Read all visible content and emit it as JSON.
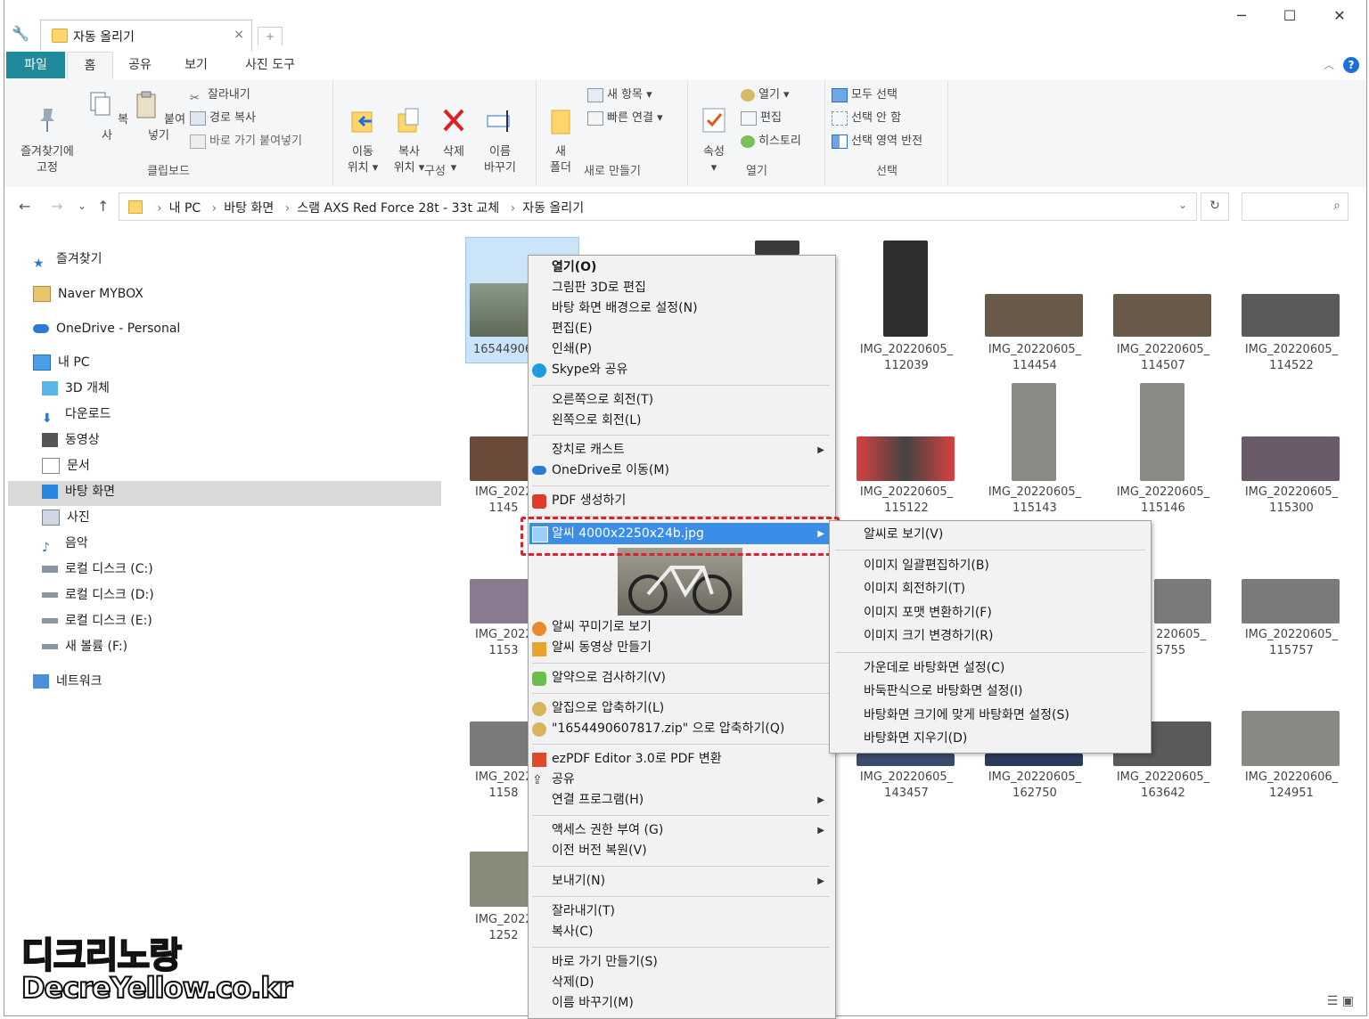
{
  "window": {
    "tab_title": "자동 올리기",
    "tab_close": "×",
    "new_tab": "+",
    "minimize": "─",
    "maximize": "☐",
    "close": "✕"
  },
  "ribbon_tabs": [
    "파일",
    "홈",
    "공유",
    "보기",
    "사진 도구"
  ],
  "ribbon": {
    "clipboard": {
      "pin_label": "즐겨찾기에\n고정",
      "copy_label": "복사",
      "paste_label": "붙여넣기",
      "cut": "잘라내기",
      "copy_path": "경로 복사",
      "paste_shortcut": "바로 가기 붙여넣기",
      "group": "클립보드"
    },
    "organize": {
      "move": "이동\n위치 ▾",
      "copy_to": "복사\n위치 ▾",
      "delete": "삭제\n▾",
      "rename": "이름\n바꾸기",
      "group": "구성"
    },
    "new": {
      "new_folder": "새\n폴더",
      "new_item": "새 항목 ▾",
      "easy_access": "빠른 연결 ▾",
      "group": "새로 만들기"
    },
    "open": {
      "properties": "속성\n▾",
      "open": "열기 ▾",
      "edit": "편집",
      "history": "히스토리",
      "group": "열기"
    },
    "select": {
      "select_all": "모두 선택",
      "select_none": "선택 안 함",
      "invert": "선택 영역 반전",
      "group": "선택"
    }
  },
  "nav_buttons": {
    "back": "←",
    "forward": "→",
    "recent": "⌄",
    "up": "↑"
  },
  "breadcrumb": [
    "내 PC",
    "바탕 화면",
    "스램 AXS Red Force 28t - 33t 교체",
    "자동 올리기"
  ],
  "breadcrumb_sep": "›",
  "address_dropdown": "⌄",
  "refresh": "↻",
  "search_icon": "⌕",
  "nav_pane": [
    {
      "label": "즐겨찾기",
      "icon": "star-icon"
    },
    {
      "label": "Naver MYBOX",
      "icon": "cloud-box-icon"
    },
    {
      "label": "OneDrive - Personal",
      "icon": "onedrive-icon"
    },
    {
      "label": "내 PC",
      "icon": "pc-icon"
    },
    {
      "label": "3D 개체",
      "icon": "cube-icon"
    },
    {
      "label": "다운로드",
      "icon": "download-icon"
    },
    {
      "label": "동영상",
      "icon": "video-icon"
    },
    {
      "label": "문서",
      "icon": "document-icon"
    },
    {
      "label": "바탕 화면",
      "icon": "desktop-icon"
    },
    {
      "label": "사진",
      "icon": "picture-icon"
    },
    {
      "label": "음악",
      "icon": "music-icon"
    },
    {
      "label": "로컬 디스크 (C:)",
      "icon": "drive-icon"
    },
    {
      "label": "로컬 디스크 (D:)",
      "icon": "drive-icon"
    },
    {
      "label": "로컬 디스크 (E:)",
      "icon": "drive-icon"
    },
    {
      "label": "새 볼륨 (F:)",
      "icon": "drive-icon"
    },
    {
      "label": "네트워크",
      "icon": "network-icon"
    }
  ],
  "files": {
    "selected": "16544906",
    "col1": [
      "IMG_2022\n1145",
      "IMG_2022\n1153",
      "IMG_2022\n1158",
      "IMG_2022\n1252"
    ],
    "grid": [
      [
        "IMG_20220605_\n112039",
        "IMG_20220605_\n114454",
        "IMG_20220605_\n114507",
        "IMG_20220605_\n114522"
      ],
      [
        "IMG_20220605_\n115122",
        "IMG_20220605_\n115143",
        "IMG_20220605_\n115146",
        "IMG_20220605_\n115300"
      ],
      [
        "220605_\n5755",
        "IMG_20220605_\n115757"
      ],
      [
        "IMG_20220605_\n143457",
        "IMG_20220605_\n162750",
        "IMG_20220605_\n163642",
        "IMG_20220606_\n124951"
      ]
    ]
  },
  "context_menu": {
    "open": "열기(O)",
    "paint3d": "그림판 3D로 편집",
    "set_bg": "바탕 화면 배경으로 설정(N)",
    "edit": "편집(E)",
    "print": "인쇄(P)",
    "skype": "Skype와 공유",
    "rotate_right": "오른쪽으로 회전(T)",
    "rotate_left": "왼쪽으로 회전(L)",
    "cast": "장치로 캐스트",
    "onedrive": "OneDrive로 이동(M)",
    "pdf": "PDF 생성하기",
    "alsee": "알씨 4000x2250x24b.jpg",
    "alsee_decor": "알씨 꾸미기로 보기",
    "alsee_video": "알씨 동영상 만들기",
    "alyac": "알약으로 검사하기(V)",
    "alzip": "알집으로 압축하기(L)",
    "alzip_zip": "\"1654490607817.zip\" 으로 압축하기(Q)",
    "ezpdf": "ezPDF Editor 3.0로 PDF 변환",
    "share": "공유",
    "open_with": "연결 프로그램(H)",
    "access": "액세스 권한 부여 (G)",
    "restore": "이전 버전 복원(V)",
    "send_to": "보내기(N)",
    "cut": "잘라내기(T)",
    "copy": "복사(C)",
    "shortcut": "바로 가기 만들기(S)",
    "delete": "삭제(D)",
    "rename": "이름 바꾸기(M)",
    "arrow": "▶"
  },
  "submenu": {
    "view": "알씨로 보기(V)",
    "batch": "이미지 일괄편집하기(B)",
    "rotate": "이미지 회전하기(T)",
    "format": "이미지 포맷 변환하기(F)",
    "resize": "이미지 크기 변경하기(R)",
    "center": "가운데로 바탕화면 설정(C)",
    "tile": "바둑판식으로 바탕화면 설정(I)",
    "fit": "바탕화면 크기에 맞게 바탕화면 설정(S)",
    "clear": "바탕화면 지우기(D)"
  },
  "watermark": {
    "line1": "디크리노랑",
    "line2": "DecreYellow.co.kr"
  },
  "colors": {
    "file_tab": "#1f8a9a",
    "highlight": "#3b8ee8",
    "dash": "#e0202a",
    "selected": "#cce4f7"
  }
}
